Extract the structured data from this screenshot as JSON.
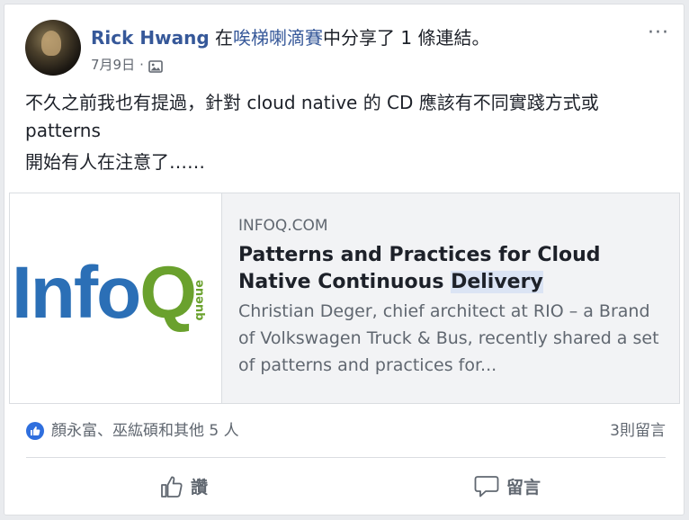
{
  "post": {
    "author_name": "Rick Hwang",
    "action_prefix": " 在",
    "group_name": "唉梯喇滴賽",
    "action_suffix": "中分享了 1 條連結。",
    "date": "7月9日",
    "meta_separator": " · ",
    "more_label": "···",
    "text_lines": [
      "不久之前我也有提過，針對 cloud native 的 CD 應該有不同實踐方式或 patterns",
      "開始有人在注意了……"
    ]
  },
  "link_preview": {
    "logo_main": "Info",
    "logo_q": "Q",
    "logo_queue": "ənənb",
    "domain": "INFOQ.COM",
    "title_part1": "Patterns and Practices for Cloud Native Continuous ",
    "title_highlight": "Delivery",
    "description": "Christian Deger, chief architect at RIO – a Brand of Volkswagen Truck & Bus, recently shared a set of patterns and practices for..."
  },
  "reactions": {
    "names": "顏永富、巫紘碩和其他 5 人",
    "comments": "3則留言"
  },
  "actions": {
    "like_label": "讚",
    "comment_label": "留言"
  },
  "colors": {
    "link_blue": "#365899",
    "like_blue": "#2f6fde",
    "infoq_blue": "#2b6fb6",
    "infoq_green": "#6aa12d"
  }
}
